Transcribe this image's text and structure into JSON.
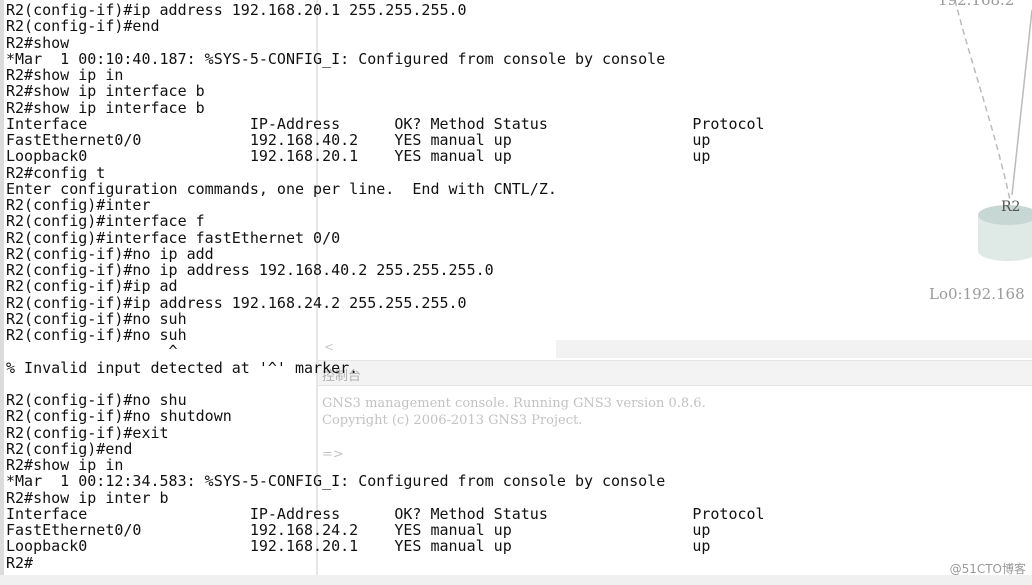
{
  "terminal": {
    "lines": [
      "R2(config-if)#ip address 192.168.20.1 255.255.255.0",
      "R2(config-if)#end",
      "R2#show",
      "*Mar  1 00:10:40.187: %SYS-5-CONFIG_I: Configured from console by console",
      "R2#show ip in",
      "R2#show ip interface b",
      "R2#show ip interface b",
      "Interface                  IP-Address      OK? Method Status                Protocol",
      "FastEthernet0/0            192.168.40.2    YES manual up                    up",
      "Loopback0                  192.168.20.1    YES manual up                    up",
      "R2#config t",
      "Enter configuration commands, one per line.  End with CNTL/Z.",
      "R2(config)#inter",
      "R2(config)#interface f",
      "R2(config)#interface fastEthernet 0/0",
      "R2(config-if)#no ip add",
      "R2(config-if)#no ip address 192.168.40.2 255.255.255.0",
      "R2(config-if)#ip ad",
      "R2(config-if)#ip address 192.168.24.2 255.255.255.0",
      "R2(config-if)#no suh",
      "R2(config-if)#no suh",
      "                  ^",
      "% Invalid input detected at '^' marker.",
      "",
      "R2(config-if)#no shu",
      "R2(config-if)#no shutdown",
      "R2(config-if)#exit",
      "R2(config)#end",
      "R2#show ip in",
      "*Mar  1 00:12:34.583: %SYS-5-CONFIG_I: Configured from console by console",
      "R2#show ip inter b",
      "Interface                  IP-Address      OK? Method Status                Protocol",
      "FastEthernet0/0            192.168.24.2    YES manual up                    up",
      "Loopback0                  192.168.20.1    YES manual up                    up",
      "R2#"
    ]
  },
  "topology": {
    "top_label": "192.168.2",
    "router_label": "R2",
    "loopback_label": "Lo0:192.168"
  },
  "console": {
    "scroll_arrow": "<",
    "title": "控制台",
    "line1": "GNS3 management console. Running GNS3 version 0.8.6.",
    "line2": "Copyright (c) 2006-2013 GNS3 Project.",
    "prompt": "=>"
  },
  "watermark": "@51CTO博客"
}
